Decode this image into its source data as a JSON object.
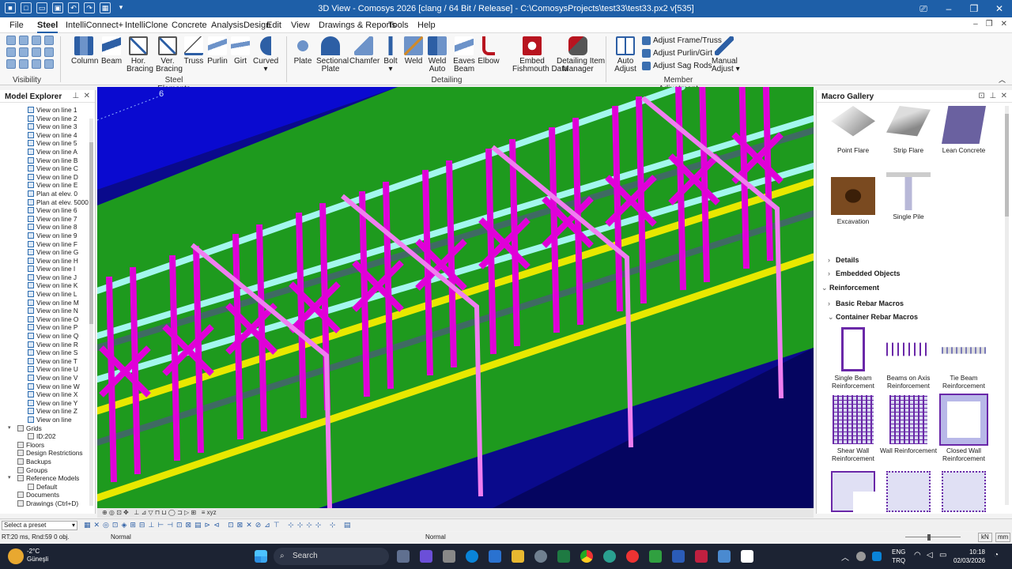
{
  "window": {
    "title": "3D View - Comosys 2026 [clang / 64 Bit / Release] - C:\\ComosysProjects\\test33\\test33.px2 v[535]"
  },
  "menu": [
    "File",
    "Steel",
    "IntelliConnect+",
    "IntelliClone",
    "Concrete",
    "AnalysisDesign",
    "Edit",
    "View",
    "Drawings & Reports",
    "Tools",
    "Help"
  ],
  "ribbon": {
    "visibility_label": "Visibility",
    "steel_elements": [
      "Column",
      "Beam",
      "Hor.\nBracing",
      "Ver.\nBracing",
      "Truss",
      "Purlin",
      "Girt",
      "Curved"
    ],
    "steel_group": "Steel Elements",
    "detailing": [
      "Plate",
      "Sectional\nPlate",
      "Chamfer",
      "Bolt",
      "Weld",
      "Weld\nAuto",
      "Eaves\nBeam",
      "Elbow",
      "Embed\nFishmouth Data",
      "Detailing Item\nManager"
    ],
    "detailing_group": "Detailing",
    "member": [
      "Auto\nAdjust",
      "Manual\nAdjust"
    ],
    "member_small": [
      "Adjust Frame/Truss",
      "Adjust Purlin/Girt",
      "Adjust Sag Rods"
    ],
    "member_group": "Member Adjustment"
  },
  "explorer": {
    "title": "Model Explorer",
    "views": [
      "View on line 1",
      "View on line 2",
      "View on line 3",
      "View on line 4",
      "View on line 5",
      "View on line A",
      "View on line B",
      "View on line C",
      "View on line D",
      "View on line E",
      "Plan at elev. 0",
      "Plan at elev. 5000",
      "View on line 6",
      "View on line 7",
      "View on line 8",
      "View on line 9",
      "View on line F",
      "View on line G",
      "View on line H",
      "View on line I",
      "View on line J",
      "View on line K",
      "View on line L",
      "View on line M",
      "View on line N",
      "View on line O",
      "View on line P",
      "View on line Q",
      "View on line R",
      "View on line S",
      "View on line T",
      "View on line U",
      "View on line V",
      "View on line W",
      "View on line X",
      "View on line Y",
      "View on line Z",
      "View on line"
    ],
    "grids": "Grids",
    "grid_id": "ID:202",
    "others": [
      "Floors",
      "Design Restrictions",
      "Backups",
      "Groups"
    ],
    "refmodels": "Reference Models",
    "ref_default": "Default",
    "tail": [
      "Documents",
      "Drawings (Ctrl+D)"
    ]
  },
  "viewport": {
    "grid_label": "6"
  },
  "gallery": {
    "title": "Macro Gallery",
    "top_items": [
      "Point Flare",
      "Strip Flare",
      "Lean Concrete",
      "Excavation",
      "Single Pile"
    ],
    "sections": [
      "Details",
      "Embedded Objects",
      "Reinforcement",
      "Basic Rebar Macros",
      "Container Rebar Macros"
    ],
    "rebar_items": [
      "Single Beam\nReinforcement",
      "Beams on Axis\nReinforcement",
      "Tie Beam\nReinforcement",
      "Shear Wall\nReinforcement",
      "Wall Reinforcement",
      "Closed Wall\nReinforcement"
    ]
  },
  "bottom": {
    "preset": "Select a preset",
    "status_left": "RT:20 ms, Rnd:59   0 obj.",
    "status_mid1": "Normal",
    "status_mid2": "Normal",
    "units": [
      "kN",
      "mm"
    ]
  },
  "taskbar": {
    "weather_temp": "-2°C",
    "weather_city": "Güneşli",
    "search": "Search",
    "lang1": "ENG",
    "lang2": "TRQ",
    "time": "10:18",
    "date": "02/03/2026"
  }
}
